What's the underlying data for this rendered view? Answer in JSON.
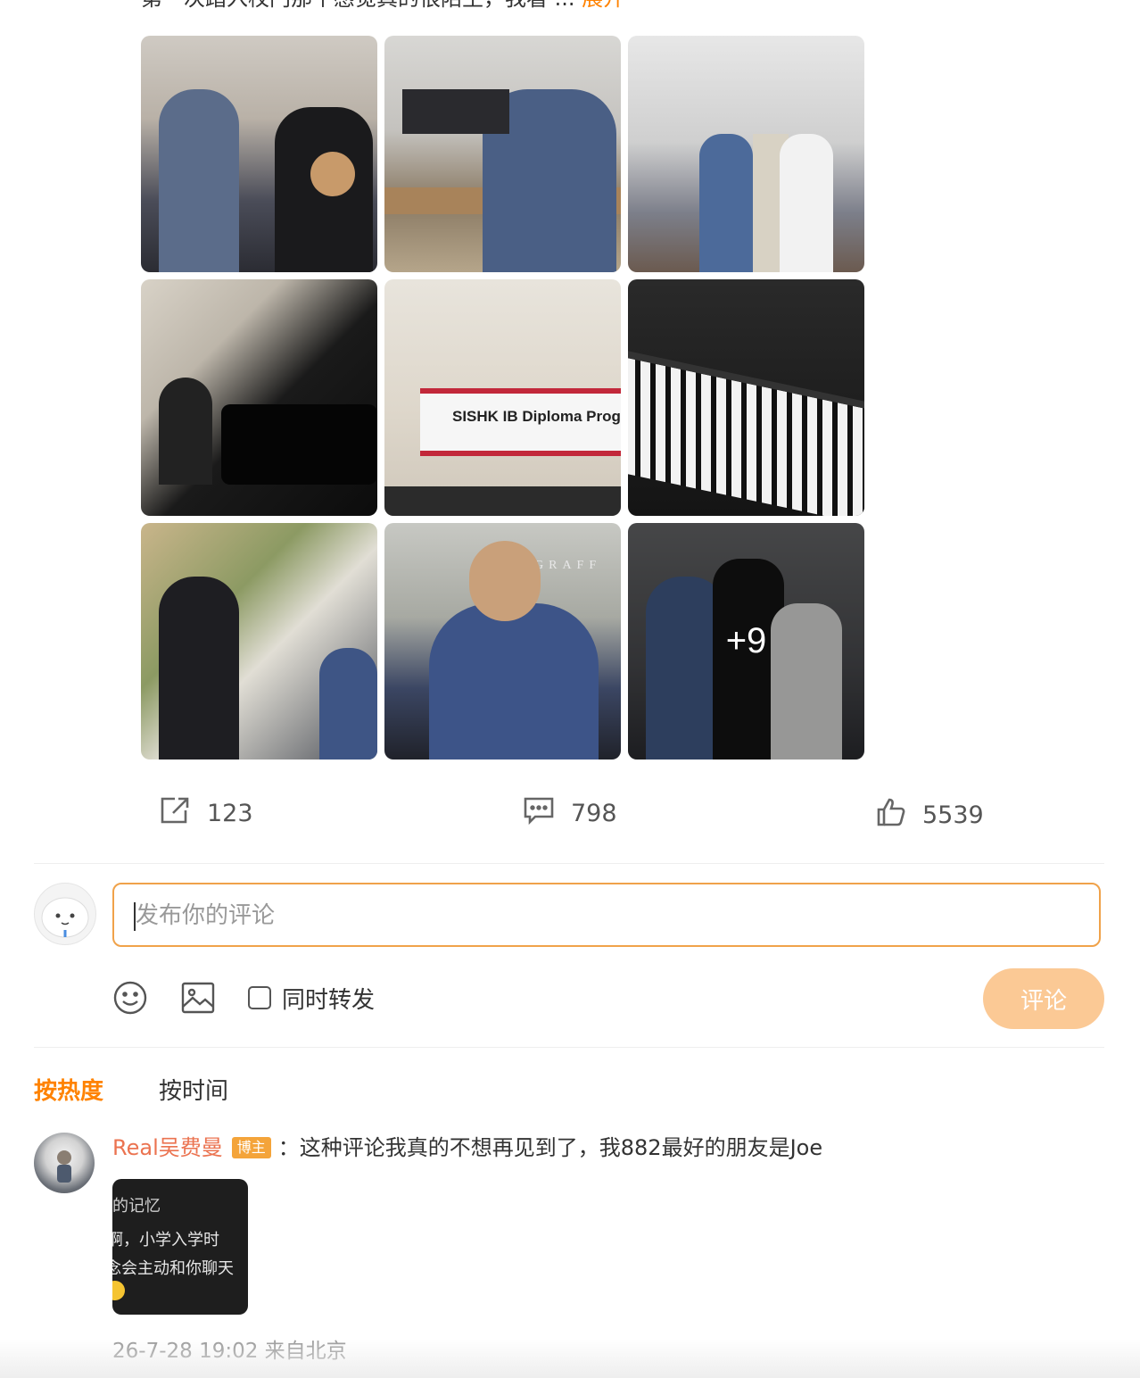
{
  "post": {
    "text_fragment": "第一次踏入校门那个感觉真的很陌生，我看 ...",
    "expand_label": "展开",
    "images_overlay_count": "+9",
    "image_banner_text": "SISHK IB Diploma Progr",
    "image_logo_text": "GRAFF"
  },
  "actions": {
    "share_count": "123",
    "comment_count": "798",
    "like_count": "5539"
  },
  "composer": {
    "placeholder": "发布你的评论",
    "repost_label": "同时转发",
    "submit_label": "评论"
  },
  "sort": {
    "hot_label": "按热度",
    "time_label": "按时间"
  },
  "comment": {
    "username": "Real吴费曼",
    "badge": "博主",
    "text": "：这种评论我真的不想再见到了，我882最好的朋友是Joe",
    "image_line1": "的记忆",
    "image_line2": "啊，小学入学时",
    "image_line3": "念会主动和你聊天",
    "meta": "26-7-28 19:02 来自北京"
  },
  "colors": {
    "accent": "#ff8200",
    "username": "#eb7350",
    "badge": "#f4a43a",
    "submit_disabled": "#fbc995",
    "input_border": "#f0a24a"
  }
}
